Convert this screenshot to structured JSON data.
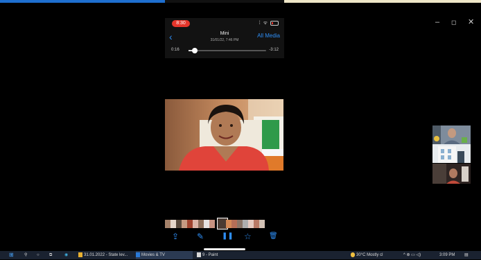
{
  "window_controls": {
    "minimize": "–",
    "maximize": "◻",
    "close": "✕"
  },
  "phone": {
    "status_time": "8:30",
    "status_icons": "⁞ ᯤ",
    "back": "‹",
    "title": "Mini",
    "subtitle": "31/01/22, 7:46 PM",
    "all_media": "All Media",
    "elapsed": "0:16",
    "remaining": "-3:12",
    "progress": 0.08
  },
  "toolbar": {
    "share": "⇪",
    "edit": "✎",
    "pause": "❚❚",
    "favorite": "☆",
    "delete": "🗑"
  },
  "thumb_colors": [
    "#a5826a",
    "#e6d6ca",
    "#5a4a3d",
    "#c69a82",
    "#a0432e",
    "#dcb4a6",
    "#8e6e5a",
    "#e6e1e0",
    "#c79382",
    "#4a3a32",
    "#d28856",
    "#b56e56",
    "#8a7466",
    "#aeaeae",
    "#e6cac0",
    "#b97a66",
    "#d2c2b6"
  ],
  "taskbar": {
    "start_icon": "⊞",
    "search_icon": "⚲",
    "cortana_icon": "○",
    "taskview_icon": "⧉",
    "edge_icon": "◉",
    "explorer_label": "31.01.2022 - State lev...",
    "movies_label": "Movies & TV",
    "paint_label": "9 - Paint",
    "weather": "30°C  Mostly cl",
    "tray": "^ ⊕ ▭ ◁)",
    "clock": "3:09 PM",
    "notify": "▤"
  }
}
